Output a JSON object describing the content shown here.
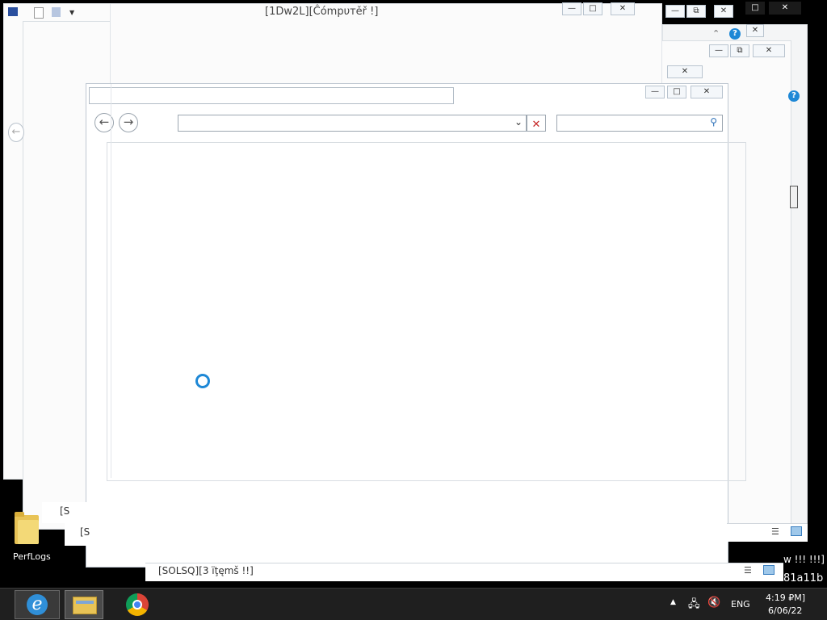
{
  "window": {
    "title": "[1Dw2L][Ĉómpυтěř !]"
  },
  "background_window": {
    "status_items": "[SOLSQ][3 ïţęmš !!]",
    "left_label_1": "[S",
    "left_label_2": "[S"
  },
  "desktop": {
    "folder_label": "PerfLogs",
    "edge_text_1": "w !!! !!!]",
    "edge_text_2": "81a11b"
  },
  "tray": {
    "language": "ENG",
    "time": "4:19 ₽M]",
    "date": "6/06/22"
  },
  "colors": {
    "accent": "#1e88d6",
    "close_red": "#c62828",
    "taskbar": "#1f1f1f"
  },
  "icons": {
    "back": "arrow-left-icon",
    "forward": "arrow-right-icon",
    "search": "magnifier-icon",
    "clear": "x-icon",
    "dropdown": "chevron-down-icon",
    "loading": "spinner-ring-icon"
  }
}
